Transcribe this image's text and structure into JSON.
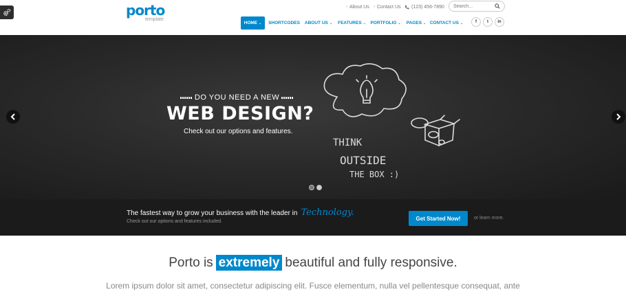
{
  "colors": {
    "accent": "#0088cc",
    "slider_bg": "#2a2a2a",
    "callout_bg": "#1b1b1b"
  },
  "header": {
    "logo": {
      "word": "porto",
      "tagline": "template"
    },
    "toplinks": {
      "about": "About Us",
      "contact": "Contact Us",
      "phone": "(123) 456-7890"
    },
    "search": {
      "placeholder": "Search..."
    },
    "nav": [
      {
        "label": "HOME",
        "active": true
      },
      {
        "label": "SHORTCODES"
      },
      {
        "label": "ABOUT US"
      },
      {
        "label": "FEATURES"
      },
      {
        "label": "PORTFOLIO"
      },
      {
        "label": "PAGES"
      },
      {
        "label": "CONTACT US"
      }
    ],
    "social": {
      "facebook": "f",
      "twitter": "t",
      "linkedin": "in"
    },
    "icons": [
      "gear-icon",
      "search-icon",
      "chevron-down-icon",
      "phone-icon",
      "facebook-icon",
      "twitter-icon",
      "linkedin-icon"
    ]
  },
  "slider": {
    "kicker": "DO YOU NEED A NEW",
    "title": "WEB DESIGN?",
    "subtitle": "Check out our options and features.",
    "chalk": {
      "line1": "THINK",
      "line2": "OUTSIDE",
      "line3": "THE BOX :)"
    },
    "pagination": {
      "count": 2,
      "active": 1
    }
  },
  "callout": {
    "text": "The fastest way to grow your business with the leader in",
    "script": "Technology.",
    "subtext": "Check out our options and features included.",
    "button": "Get Started Now!",
    "learn_more": "or learn more."
  },
  "intro": {
    "before": "Porto is",
    "highlight": "extremely",
    "after": "beautiful and fully responsive.",
    "lorem": "Lorem ipsum dolor sit amet, consectetur adipiscing elit. Fusce elementum, nulla vel pellentesque consequat, ante"
  }
}
